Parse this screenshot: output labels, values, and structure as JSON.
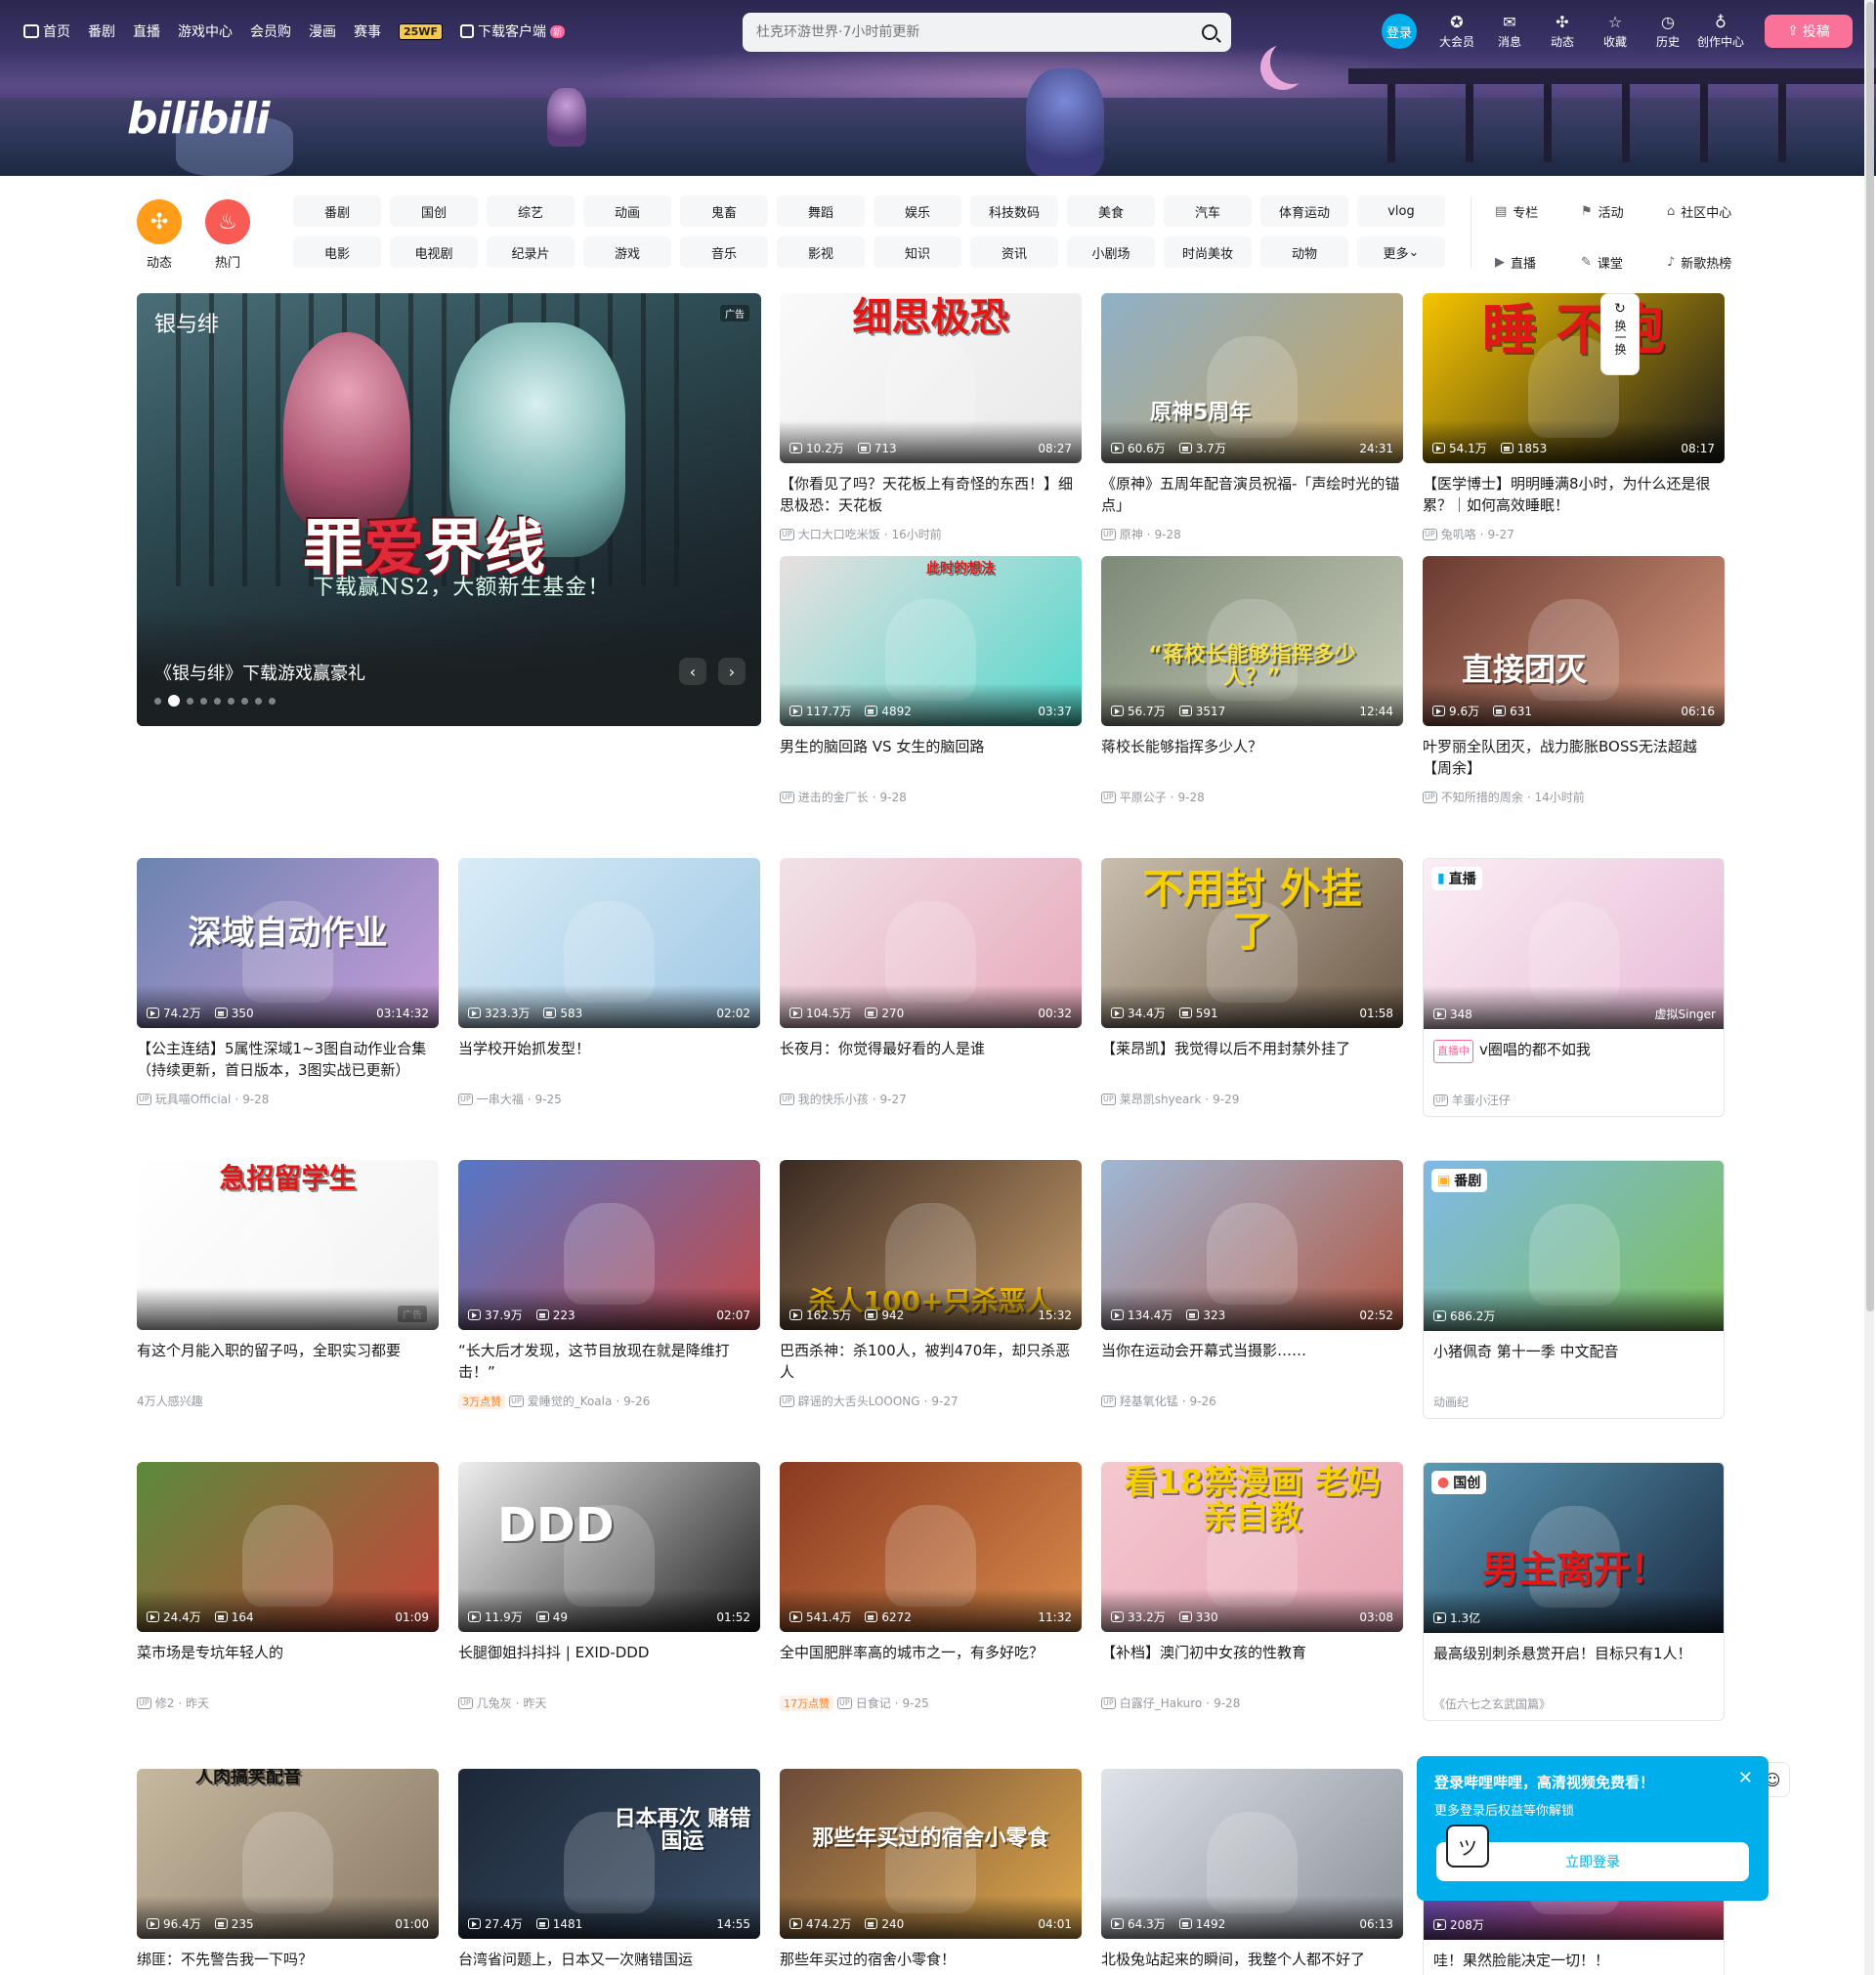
{
  "nav": {
    "home": "首页",
    "items": [
      "番剧",
      "直播",
      "游戏中心",
      "会员购",
      "漫画",
      "赛事"
    ],
    "badge": "25WF",
    "download": "下载客户端",
    "download_badge": "新",
    "search_placeholder": "杜克环游世界·7小时前更新",
    "login": "登录",
    "right_items": [
      {
        "label": "大会员",
        "icon": "vip-icon"
      },
      {
        "label": "消息",
        "icon": "message-icon"
      },
      {
        "label": "动态",
        "icon": "dynamic-icon"
      },
      {
        "label": "收藏",
        "icon": "favorite-icon"
      },
      {
        "label": "历史",
        "icon": "history-icon"
      },
      {
        "label": "创作中心",
        "icon": "creator-icon"
      }
    ],
    "upload": "投稿"
  },
  "logo": "bilibili",
  "channels": {
    "dynamic": "动态",
    "hot": "热门",
    "row1": [
      "番剧",
      "国创",
      "综艺",
      "动画",
      "鬼畜",
      "舞蹈",
      "娱乐",
      "科技数码",
      "美食",
      "汽车",
      "体育运动",
      "vlog"
    ],
    "row2": [
      "电影",
      "电视剧",
      "纪录片",
      "游戏",
      "音乐",
      "影视",
      "知识",
      "资讯",
      "小剧场",
      "时尚美妆",
      "动物",
      "更多"
    ],
    "side": [
      "专栏",
      "活动",
      "社区中心",
      "直播",
      "课堂",
      "新歌热榜"
    ]
  },
  "carousel": {
    "logo_text": "银与绯",
    "ad": "广告",
    "title_a": "罪",
    "title_b": "爱",
    "title_c": "界线",
    "subtitle": "下载赢NS2，大额新生基金！",
    "caption": "《银与绯》下载游戏赢豪礼",
    "dot_count": 9,
    "active_dot": 1
  },
  "refresh": "换一换",
  "cards": [
    {
      "title": "【你看见了吗？天花板上有奇怪的东西！】细思极恐：天花板",
      "views": "10.2万",
      "danmaku": "713",
      "duration": "08:27",
      "author": "大口大口吃米饭",
      "date": "16小时前",
      "thumb_text": "细思极恐",
      "colors": [
        "#fafafa",
        "#e8e8e8"
      ]
    },
    {
      "title": "《原神》五周年配音演员祝福-「声绘时光的锚点」",
      "views": "60.6万",
      "danmaku": "3.7万",
      "duration": "24:31",
      "author": "原神",
      "date": "9-28",
      "thumb_text": "原神5周年",
      "colors": [
        "#8fb0c8",
        "#c7a35a"
      ]
    },
    {
      "title": "【医学博士】明明睡满8小时，为什么还是很累？｜如何高效睡眠！",
      "views": "54.1万",
      "danmaku": "1853",
      "duration": "08:17",
      "author": "兔叽咯",
      "date": "9-27",
      "thumb_text": "睡 不饱",
      "colors": [
        "#f6c400",
        "#1a1a1a"
      ]
    },
    {
      "title": "男生的脑回路 VS 女生的脑回路",
      "views": "117.7万",
      "danmaku": "4892",
      "duration": "03:37",
      "author": "进击的金厂长",
      "date": "9-28",
      "thumb_text": "此时的想法",
      "colors": [
        "#e8e0e0",
        "#50d8cc"
      ]
    },
    {
      "title": "蒋校长能够指挥多少人？",
      "views": "56.7万",
      "danmaku": "3517",
      "duration": "12:44",
      "author": "平原公子",
      "date": "9-28",
      "thumb_text": "“蒋校长能够指挥多少人？”",
      "colors": [
        "#7d8a78",
        "#c8cdb9"
      ]
    },
    {
      "title": "叶罗丽全队团灭，战力膨胀BOSS无法超越【周余】",
      "views": "9.6万",
      "danmaku": "631",
      "duration": "06:16",
      "author": "不知所措的周余",
      "date": "14小时前",
      "thumb_text": "直接团灭",
      "colors": [
        "#6a3a30",
        "#d89a80"
      ]
    },
    {
      "title": "【公主连结】5属性深域1~3图自动作业合集（持续更新，首日版本，3图实战已更新）",
      "views": "74.2万",
      "danmaku": "350",
      "duration": "03:14:32",
      "author": "玩具喵Official",
      "date": "9-28",
      "thumb_text": "深域自动作业",
      "colors": [
        "#6b84b0",
        "#c79bd8"
      ]
    },
    {
      "title": "当学校开始抓发型！",
      "views": "323.3万",
      "danmaku": "583",
      "duration": "02:02",
      "author": "一串大福",
      "date": "9-25",
      "thumb_text": "",
      "colors": [
        "#d9ecf7",
        "#9fc8e4"
      ]
    },
    {
      "title": "长夜月：你觉得最好看的人是谁",
      "views": "104.5万",
      "danmaku": "270",
      "duration": "00:32",
      "author": "我的快乐小孩",
      "date": "9-27",
      "thumb_text": "",
      "colors": [
        "#f1e2e8",
        "#e7a8bb"
      ]
    },
    {
      "title": "【莱昂凯】我觉得以后不用封禁外挂了",
      "views": "34.4万",
      "danmaku": "591",
      "duration": "01:58",
      "author": "莱昂凯shyeark",
      "date": "9-29",
      "thumb_text": "不用封 外挂了",
      "colors": [
        "#c9bfae",
        "#6e5a48"
      ]
    },
    {
      "title": "有这个月能入职的留子吗，全职实习都要",
      "views": "",
      "danmaku": "",
      "duration": "",
      "author": "4万人感兴趣",
      "date": "",
      "thumb_text": "急招留学生",
      "colors": [
        "#ffffff",
        "#f2f2f2"
      ],
      "ad": "广告"
    },
    {
      "title": "“长大后才发现，这节目放现在就是降维打击！”",
      "views": "37.9万",
      "danmaku": "223",
      "duration": "02:07",
      "author": "爱睡觉的_Koala",
      "date": "9-26",
      "hot": "3万点赞",
      "thumb_text": "",
      "colors": [
        "#5577c8",
        "#c34a4a"
      ]
    },
    {
      "title": "巴西杀神：杀100人，被判470年，却只杀恶人",
      "views": "162.5万",
      "danmaku": "942",
      "duration": "15:32",
      "author": "辟谣的大舌头LOOONG",
      "date": "9-27",
      "thumb_text": "杀人100+只杀恶人",
      "colors": [
        "#3a2a22",
        "#c49a6a"
      ]
    },
    {
      "title": "当你在运动会开幕式当摄影……",
      "views": "134.4万",
      "danmaku": "323",
      "duration": "02:52",
      "author": "羟基氧化锰",
      "date": "9-26",
      "thumb_text": "",
      "colors": [
        "#9eb8d6",
        "#b35a45"
      ]
    },
    {
      "title": "菜市场是专坑年轻人的",
      "views": "24.4万",
      "danmaku": "164",
      "duration": "01:09",
      "author": "修2",
      "date": "昨天",
      "thumb_text": "",
      "colors": [
        "#5b8a3c",
        "#c8453a"
      ]
    },
    {
      "title": "长腿御姐抖抖抖 | EXID-DDD",
      "views": "11.9万",
      "danmaku": "49",
      "duration": "01:52",
      "author": "几兔灰",
      "date": "昨天",
      "thumb_text": "DDD",
      "colors": [
        "#eeeeee",
        "#222222"
      ]
    },
    {
      "title": "全中国肥胖率高的城市之一，有多好吃？",
      "views": "541.4万",
      "danmaku": "6272",
      "duration": "11:32",
      "author": "日食记",
      "date": "9-25",
      "hot": "17万点赞",
      "thumb_text": "",
      "colors": [
        "#8a3a20",
        "#d98a4a"
      ]
    },
    {
      "title": "【补档】澳门初中女孩的性教育",
      "views": "33.2万",
      "danmaku": "330",
      "duration": "03:08",
      "author": "白露仔_Hakuro",
      "date": "9-28",
      "thumb_text": "看18禁漫画 老妈亲自教",
      "colors": [
        "#f4c8d0",
        "#e9a5b4"
      ]
    },
    {
      "title": "绑匪：不先警告我一下吗？",
      "views": "96.4万",
      "danmaku": "235",
      "duration": "01:00",
      "author": "",
      "date": "",
      "thumb_text": "人肉搞笑配音",
      "colors": [
        "#c7b8a0",
        "#8a7a66"
      ]
    },
    {
      "title": "台湾省问题上，日本又一次赌错国运",
      "views": "27.4万",
      "danmaku": "1481",
      "duration": "14:55",
      "author": "",
      "date": "",
      "thumb_text": "日本再次 赌错国运",
      "colors": [
        "#1c2838",
        "#3a4e66"
      ]
    },
    {
      "title": "那些年买过的宿舍小零食！",
      "views": "474.2万",
      "danmaku": "240",
      "duration": "04:01",
      "author": "",
      "date": "",
      "thumb_text": "那些年买过的宿舍小零食",
      "colors": [
        "#6a4a3a",
        "#e0a84a"
      ]
    },
    {
      "title": "北极兔站起来的瞬间，我整个人都不好了",
      "views": "64.3万",
      "danmaku": "1492",
      "duration": "06:13",
      "author": "",
      "date": "",
      "thumb_text": "",
      "colors": [
        "#dfe4ea",
        "#8a9098"
      ]
    }
  ],
  "specials": [
    {
      "tag": "直播",
      "title": "v圈唱的都不如我",
      "live_tag": "直播中",
      "views": "348",
      "subtag": "虚拟Singer",
      "author": "羊蛋小汪仔",
      "colors": [
        "#fbeef4",
        "#e7b9d6"
      ]
    },
    {
      "tag": "番剧",
      "title": "小猪佩奇 第十一季 中文配音",
      "views": "686.2万",
      "author": "动画纪",
      "colors": [
        "#7fb9e8",
        "#7cc05a"
      ]
    },
    {
      "tag": "国创",
      "title": "最高级别刺杀悬赏开启！目标只有1人！",
      "views": "1.3亿",
      "author": "《伍六七之玄武国篇》",
      "thumb_text": "男主离开！",
      "colors": [
        "#5a9ab8",
        "#1a2a40"
      ]
    },
    {
      "tag": "",
      "title": "哇！果然脸能决定一切！！",
      "views": "208万",
      "author": "",
      "colors": [
        "#3a4ac8",
        "#e24a6a"
      ]
    }
  ],
  "login_popup": {
    "title": "登录哔哩哔哩，高清视频免费看！",
    "subtitle": "更多登录后权益等你解锁",
    "button": "立即登录"
  }
}
